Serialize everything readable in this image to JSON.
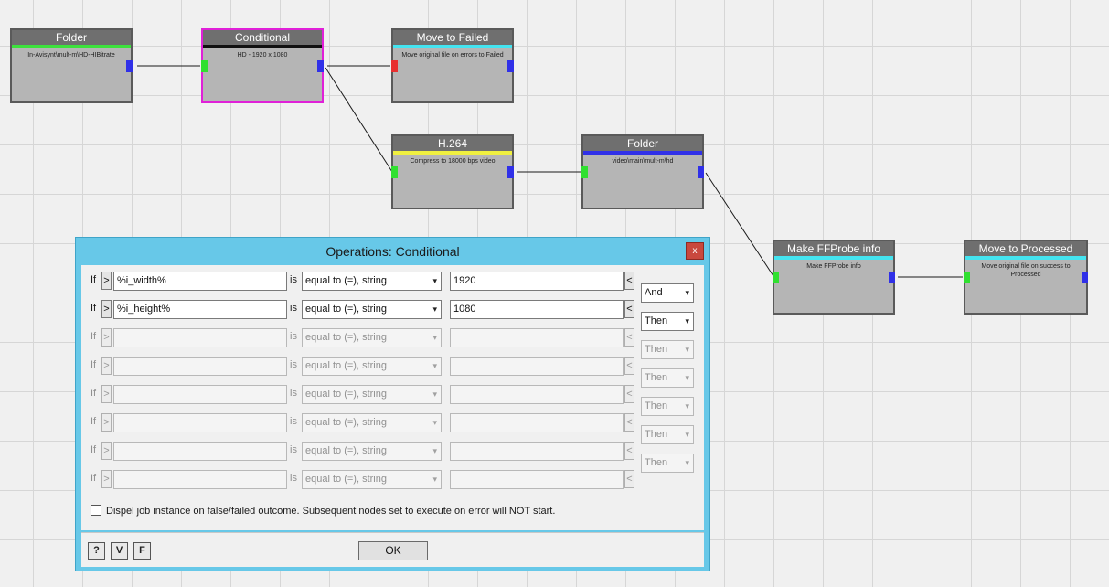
{
  "nodes": [
    {
      "id": "folder1",
      "title": "Folder",
      "desc": "In-Avisynt\\mult-m\\HD-HIBitrate",
      "bar": "#3ce23c"
    },
    {
      "id": "conditional",
      "title": "Conditional",
      "desc": "HD - 1920 x 1080",
      "bar": "#111111"
    },
    {
      "id": "failed",
      "title": "Move to Failed",
      "desc": "Move original file on errors to Failed",
      "bar": "#44e4f0"
    },
    {
      "id": "h264",
      "title": "H.264",
      "desc": "Compress to 18000 bps video",
      "bar": "#f0f040"
    },
    {
      "id": "folder2",
      "title": "Folder",
      "desc": "video\\main\\mult-m\\hd",
      "bar": "#3030e8"
    },
    {
      "id": "ffprobe",
      "title": "Make FFProbe info",
      "desc": "Make FFProbe info",
      "bar": "#44e4f0"
    },
    {
      "id": "processed",
      "title": "Move to Processed",
      "desc": "Move original file on success to Processed",
      "bar": "#44e4f0"
    }
  ],
  "dialog": {
    "title": "Operations: Conditional",
    "close": "x",
    "if_label": "If",
    "is_label": "is",
    "gt": ">",
    "lt": "<",
    "arrow": "▾",
    "rows": [
      {
        "left": "%i_width%",
        "op": "equal to (=), string",
        "right": "1920",
        "enabled": true
      },
      {
        "left": "%i_height%",
        "op": "equal to (=), string",
        "right": "1080",
        "enabled": true
      },
      {
        "left": "",
        "op": "equal to (=), string",
        "right": "",
        "enabled": false
      },
      {
        "left": "",
        "op": "equal to (=), string",
        "right": "",
        "enabled": false
      },
      {
        "left": "",
        "op": "equal to (=), string",
        "right": "",
        "enabled": false
      },
      {
        "left": "",
        "op": "equal to (=), string",
        "right": "",
        "enabled": false
      },
      {
        "left": "",
        "op": "equal to (=), string",
        "right": "",
        "enabled": false
      },
      {
        "left": "",
        "op": "equal to (=), string",
        "right": "",
        "enabled": false
      }
    ],
    "chains": [
      {
        "value": "And",
        "enabled": true
      },
      {
        "value": "Then",
        "enabled": true
      },
      {
        "value": "Then",
        "enabled": false
      },
      {
        "value": "Then",
        "enabled": false
      },
      {
        "value": "Then",
        "enabled": false
      },
      {
        "value": "Then",
        "enabled": false
      },
      {
        "value": "Then",
        "enabled": false
      }
    ],
    "dispel_text": "Dispel job instance on false/failed outcome. Subsequent nodes set to execute on error will NOT start.",
    "footer": {
      "help": "?",
      "v": "V",
      "f": "F",
      "ok": "OK"
    }
  }
}
